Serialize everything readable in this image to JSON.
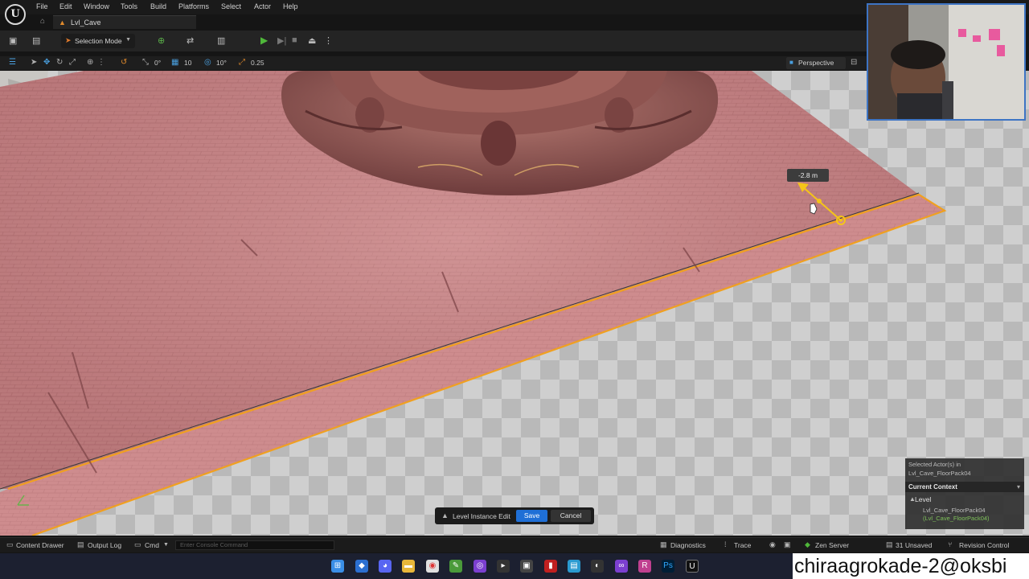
{
  "app": {
    "logo_text": "U"
  },
  "menu": [
    "File",
    "Edit",
    "Window",
    "Tools",
    "Build",
    "Platforms",
    "Select",
    "Actor",
    "Help"
  ],
  "tab": {
    "level_name": "Lvl_Cave"
  },
  "toolbar": {
    "mode_label": "Selection Mode"
  },
  "viewport_toolbar": {
    "grid_rotate_value": "0°",
    "grid_value": "10",
    "angle_value": "10°",
    "scale_value": "0.25",
    "view_mode": "Perspective"
  },
  "viewport": {
    "measure_label": "-2.8 m"
  },
  "context_panel": {
    "selected_line1": "Selected Actor(s) in",
    "selected_line2": "Lvl_Cave_FloorPack04",
    "header": "Current Context",
    "level_label": "Level",
    "actor_line1": "Lvl_Cave_FloorPack04",
    "actor_line2": "(Lvl_Cave_FloorPack04)"
  },
  "level_instance_bar": {
    "label": "Level Instance Edit",
    "save": "Save",
    "cancel": "Cancel"
  },
  "statusbar": {
    "content_drawer": "Content Drawer",
    "output_log": "Output Log",
    "cmd": "Cmd",
    "console_placeholder": "Enter Console Command",
    "diagnostics": "Diagnostics",
    "trace": "Trace",
    "zen_server": "Zen Server",
    "unsaved": "31 Unsaved",
    "revision_control": "Revision Control"
  },
  "watermark": "chiraagrokade-2@oksbi",
  "colors": {
    "accent_orange": "#f0a020",
    "save_blue": "#1f6fd6",
    "floor_pink": "#c98a8c",
    "play_green": "#4fb83a",
    "webcam_border": "#3d74c4"
  }
}
